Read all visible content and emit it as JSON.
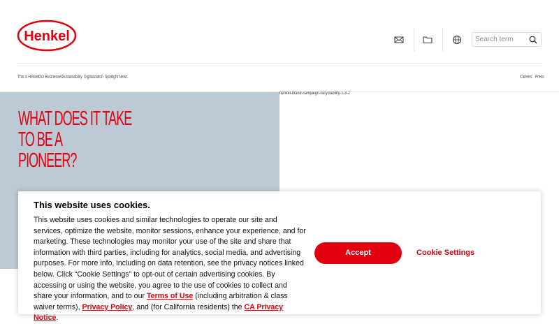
{
  "brand": {
    "logo_text": "Henkel",
    "accent_color": "#e1000f"
  },
  "header": {
    "icons": [
      "mail-icon",
      "folder-icon",
      "globe-icon"
    ],
    "search": {
      "placeholder": "Search term"
    }
  },
  "nav": {
    "left": [
      "This is Henkel",
      "Our Businesses",
      "Sustainability",
      "Digitalization",
      "Spotlight News"
    ],
    "right": [
      "Careers",
      "Press"
    ]
  },
  "hero": {
    "title_lines": [
      "WHAT DOES IT TAKE",
      "TO BE A",
      "PIONEER?"
    ],
    "image_alt": "henkel-brand-campaign-recyclability-1-3-2",
    "panel_color": "#bccad6"
  },
  "cookie": {
    "title": "This website uses cookies.",
    "body_main": "This website uses cookies and similar technologies to operate our site and services, optimize the website, monitor sessions, enhance your experience, and for marketing. These technologies may monitor your use of the site and share that information with third parties, including for analytics, social media, and advertising purposes. For more info, including on data retention, see the privacy notices linked below. Click “Cookie Settings” to opt-out of certain advertising cookies. By accessing or using the website, you agree to the use of cookies to collect and share your information, and to our ",
    "terms_link": "Terms of Use",
    "text_after_terms": " (including arbitration & class waiver terms), ",
    "privacy_link": "Privacy Policy",
    "text_after_privacy": ", and (for California residents) the ",
    "ca_link": "CA Privacy Notice",
    "text_end": ".",
    "accept_label": "Accept",
    "settings_label": "Cookie Settings"
  }
}
